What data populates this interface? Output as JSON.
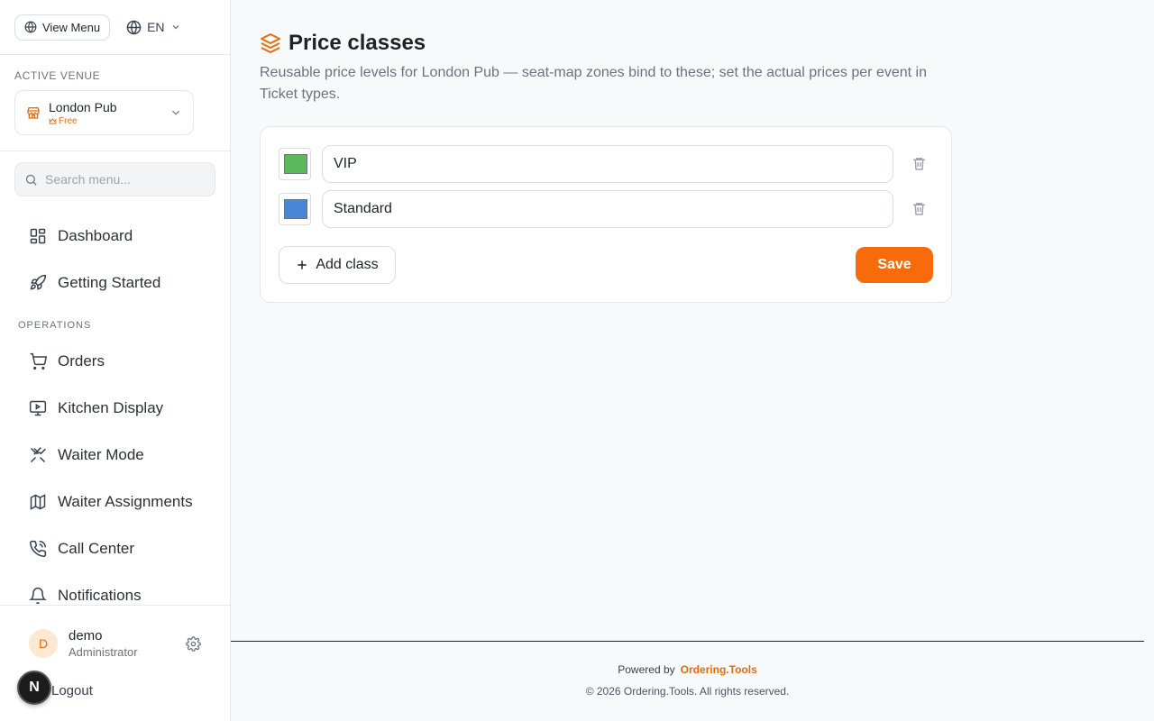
{
  "topbar": {
    "view_menu_label": "View Menu",
    "language": "EN"
  },
  "venue": {
    "section_label": "ACTIVE VENUE",
    "name": "London Pub",
    "plan": "Free"
  },
  "search": {
    "placeholder": "Search menu..."
  },
  "nav": {
    "dashboard": "Dashboard",
    "getting_started": "Getting Started",
    "operations_label": "OPERATIONS",
    "orders": "Orders",
    "kitchen_display": "Kitchen Display",
    "waiter_mode": "Waiter Mode",
    "waiter_assignments": "Waiter Assignments",
    "call_center": "Call Center",
    "notifications": "Notifications"
  },
  "user": {
    "initial": "D",
    "name": "demo",
    "role": "Administrator",
    "logout_label": "Logout",
    "badge_letter": "N"
  },
  "page": {
    "title": "Price classes",
    "description": "Reusable price levels for London Pub — seat-map zones bind to these; set the actual prices per event in Ticket types."
  },
  "price_classes": [
    {
      "name": "VIP",
      "color": "#5cb85c"
    },
    {
      "name": "Standard",
      "color": "#4a86d6"
    }
  ],
  "actions": {
    "add_label": "Add class",
    "save_label": "Save"
  },
  "footer": {
    "powered_by": "Powered by",
    "brand": "Ordering.Tools",
    "copyright": "© 2026 Ordering.Tools. All rights reserved."
  },
  "colors": {
    "accent": "#f86b0a",
    "brand_text": "#ea6a0a"
  }
}
